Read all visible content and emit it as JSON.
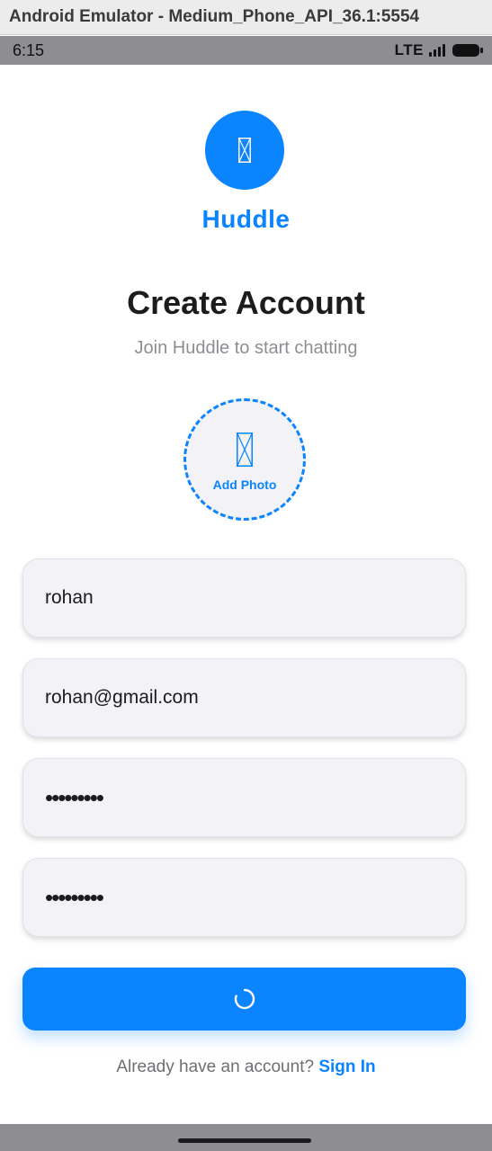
{
  "window": {
    "title": "Android Emulator - Medium_Phone_API_36.1:5554"
  },
  "status_bar": {
    "time": "6:15",
    "network": "LTE"
  },
  "app": {
    "name": "Huddle"
  },
  "screen": {
    "title": "Create Account",
    "subtitle": "Join Huddle to start chatting"
  },
  "photo": {
    "label": "Add Photo"
  },
  "form": {
    "name_value": "rohan",
    "email_value": "rohan@gmail.com",
    "password_value": "•••••••••",
    "confirm_password_value": "•••••••••"
  },
  "footer": {
    "prompt": "Already have an account?",
    "link": "Sign In"
  },
  "colors": {
    "accent": "#0a84ff",
    "field_bg": "#f2f2f7"
  },
  "icons": {
    "logo": "missing-glyph-icon",
    "photo": "missing-glyph-icon",
    "submit": "loading-spinner-icon"
  }
}
